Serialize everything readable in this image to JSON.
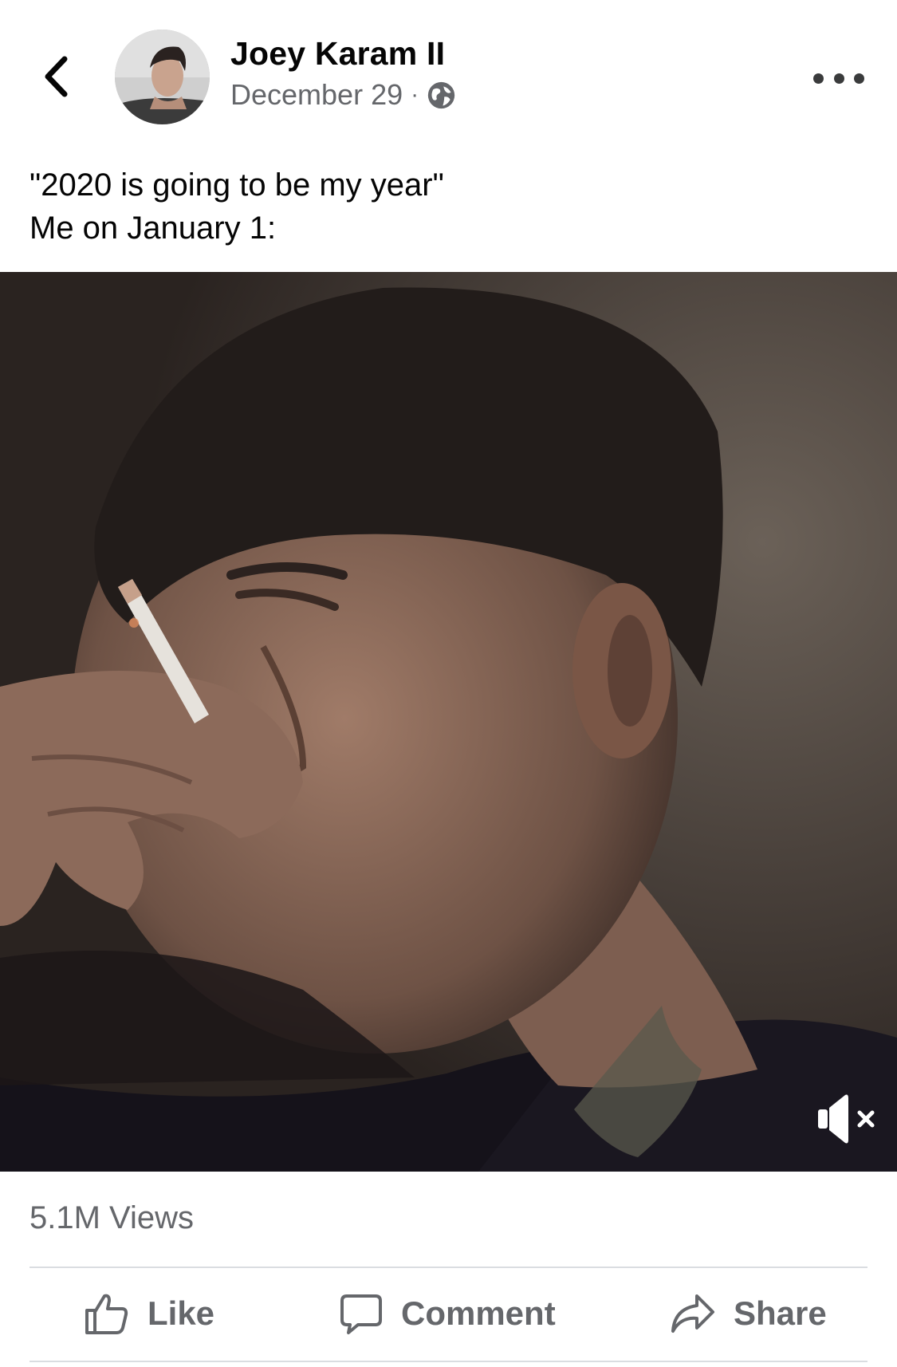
{
  "header": {
    "author_name": "Joey Karam II",
    "date": "December 29",
    "separator": "·",
    "privacy_icon": "globe-icon",
    "back_icon": "chevron-left-icon",
    "more_icon": "more-horizontal-icon"
  },
  "post": {
    "caption": "\"2020 is going to be my year\"\nMe on January 1:",
    "video": {
      "muted": true,
      "mute_icon": "speaker-muted-icon"
    }
  },
  "stats": {
    "views": "5.1M Views"
  },
  "actions": {
    "like_label": "Like",
    "comment_label": "Comment",
    "share_label": "Share",
    "like_icon": "thumbs-up-icon",
    "comment_icon": "comment-bubble-icon",
    "share_icon": "share-arrow-icon"
  },
  "colors": {
    "text_primary": "#050505",
    "text_secondary": "#65676b",
    "divider": "#dadde1",
    "background": "#ffffff"
  }
}
